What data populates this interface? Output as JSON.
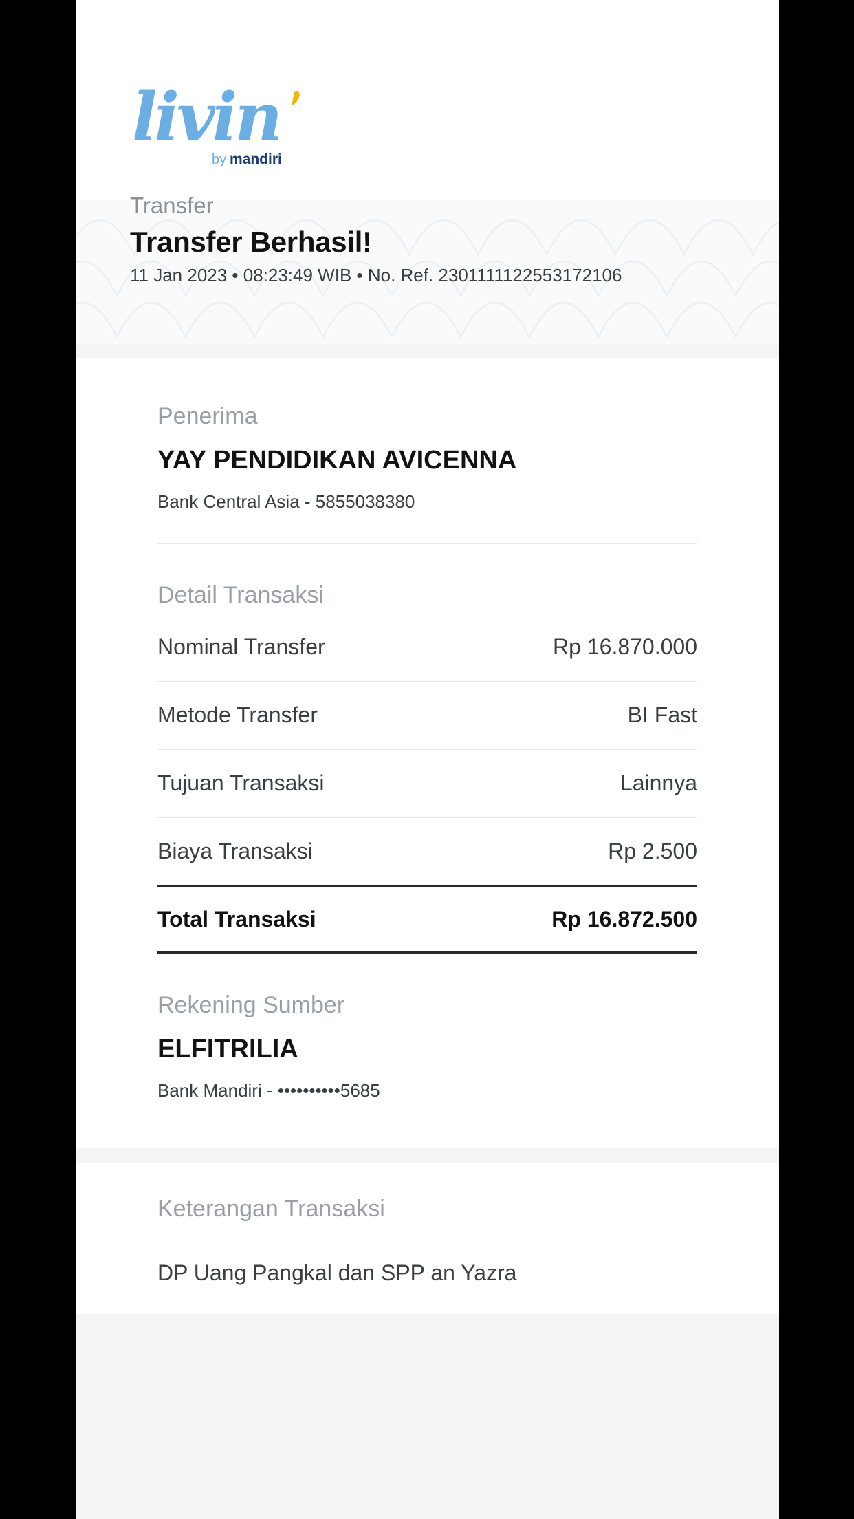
{
  "brand": {
    "logo_word": "livin'",
    "logo_by": "by mandiri"
  },
  "header": {
    "category": "Transfer",
    "title": "Transfer Berhasil!",
    "meta": "11 Jan 2023 • 08:23:49 WIB • No. Ref. 2301111122553172106"
  },
  "recipient": {
    "label": "Penerima",
    "name": "YAY PENDIDIKAN AVICENNA",
    "account": "Bank Central Asia - 5855038380"
  },
  "details": {
    "label": "Detail Transaksi",
    "rows": [
      {
        "label": "Nominal Transfer",
        "value": "Rp 16.870.000"
      },
      {
        "label": "Metode Transfer",
        "value": "BI Fast"
      },
      {
        "label": "Tujuan Transaksi",
        "value": "Lainnya"
      },
      {
        "label": "Biaya Transaksi",
        "value": "Rp 2.500"
      }
    ],
    "total": {
      "label": "Total Transaksi",
      "value": "Rp 16.872.500"
    }
  },
  "source": {
    "label": "Rekening Sumber",
    "name": "ELFITRILIA",
    "account": "Bank Mandiri - ••••••••••5685"
  },
  "notes": {
    "label": "Keterangan Transaksi",
    "text": "DP Uang Pangkal dan SPP an Yazra"
  },
  "colors": {
    "brand_blue": "#6aaee3",
    "brand_navy": "#1b3c78",
    "brand_yellow": "#f2b705"
  }
}
